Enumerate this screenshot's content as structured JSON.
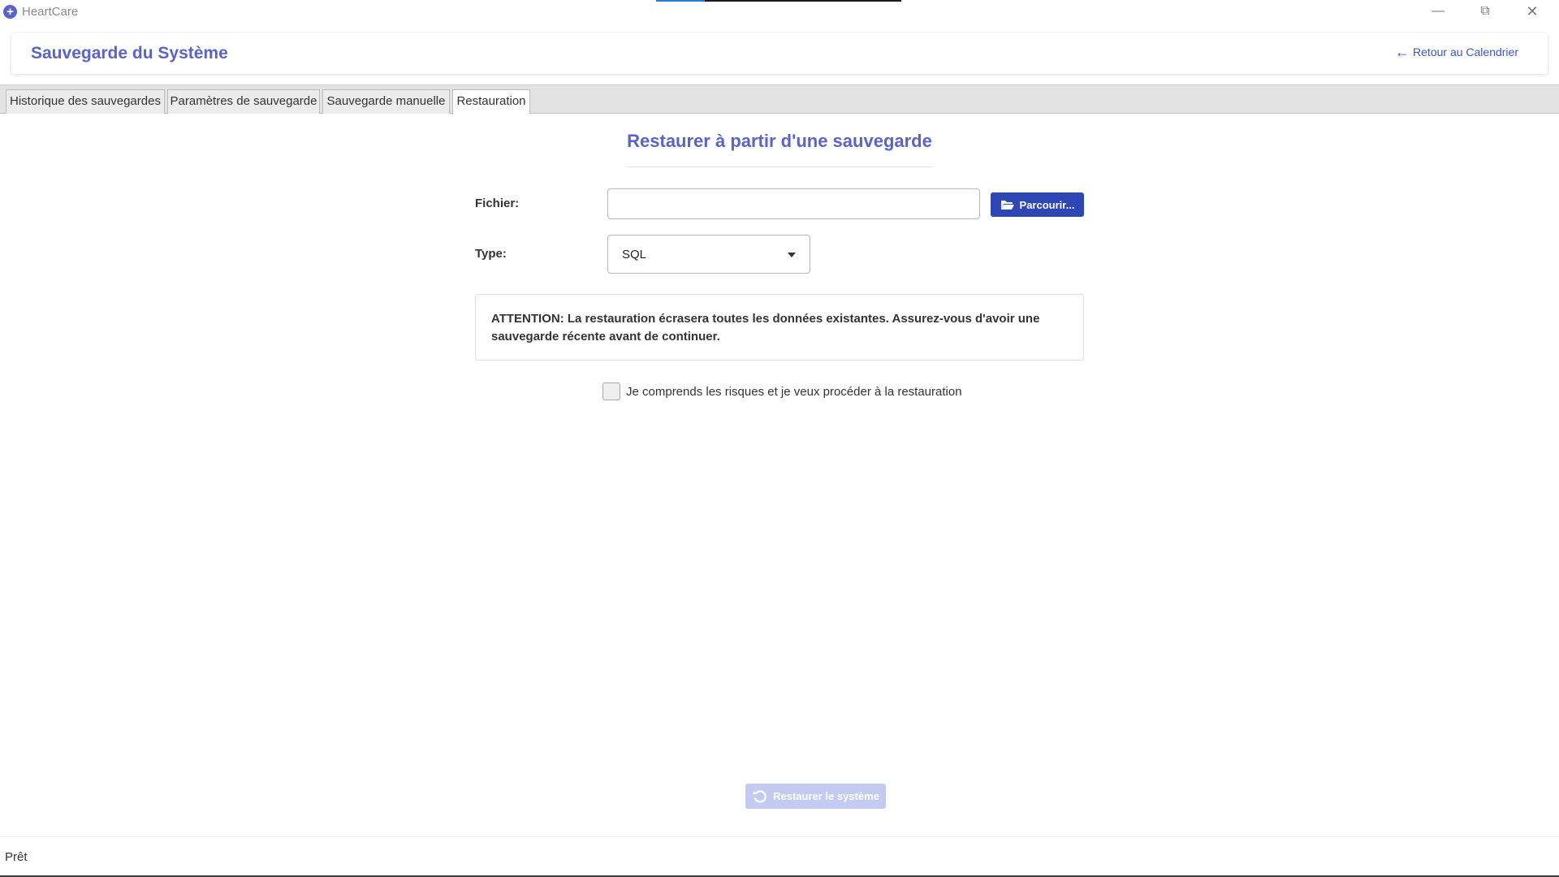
{
  "window": {
    "app_title": "HeartCare",
    "app_icon": "plus-circle-icon",
    "minimize_icon": "minimize-icon",
    "maximize_icon": "restore-window-icon",
    "close_icon": "close-icon",
    "loading_progress": 0.2
  },
  "header": {
    "title": "Sauvegarde du Système",
    "back_link": "Retour au Calendrier",
    "back_icon": "arrow-left-icon"
  },
  "tabs": [
    {
      "label": "Historique des sauvegardes",
      "active": false
    },
    {
      "label": "Paramètres de sauvegarde",
      "active": false
    },
    {
      "label": "Sauvegarde manuelle",
      "active": false
    },
    {
      "label": "Restauration",
      "active": true
    }
  ],
  "restore": {
    "title": "Restaurer à partir d'une sauvegarde",
    "file_label": "Fichier:",
    "file_value": "",
    "browse_label": "Parcourir...",
    "browse_icon": "folder-open-icon",
    "type_label": "Type:",
    "type_value": "SQL",
    "warning": "ATTENTION: La restauration écrasera toutes les données existantes. Assurez-vous d'avoir une sauvegarde récente avant de continuer.",
    "confirm_label": "Je comprends les risques et je veux procéder à la restauration",
    "confirm_checked": false,
    "restore_button": "Restaurer le système",
    "restore_icon": "undo-icon",
    "restore_enabled": false
  },
  "colors": {
    "accent": "#5a64c8",
    "primary_button": "#2f47b5",
    "disabled_button": "#c4cbf0",
    "link": "#3a55c8"
  },
  "status": {
    "text": "Prêt"
  }
}
